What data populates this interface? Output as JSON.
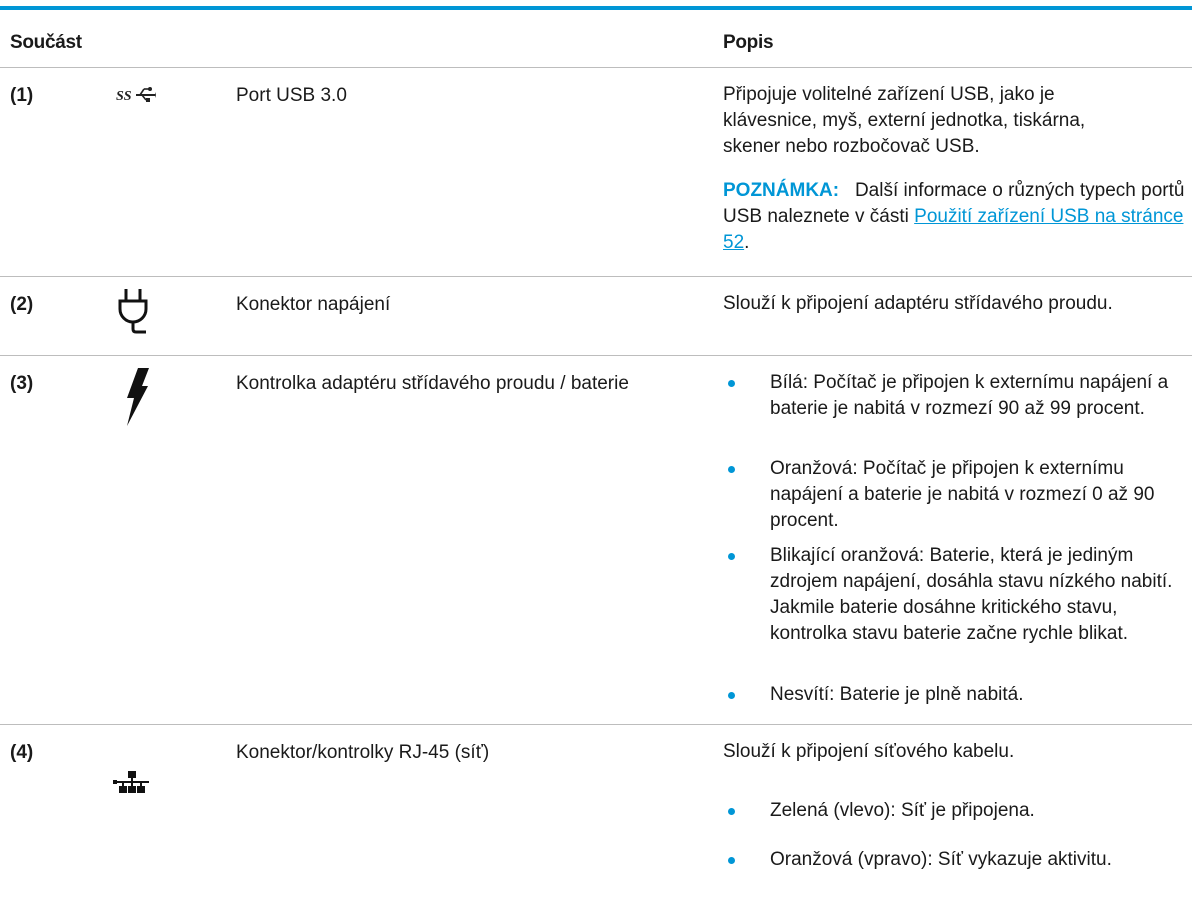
{
  "header": {
    "col1": "Součást",
    "col2": "Popis"
  },
  "rows": [
    {
      "num": "(1)",
      "icon": "superspeed-usb-icon",
      "name": "Port USB 3.0",
      "desc": "Připojuje volitelné zařízení USB, jako je klávesnice, myš, externí jednotka, tiskárna, skener nebo rozbočovač USB.",
      "note_label": "POZNÁMKA:",
      "note_text": "Další informace o různých typech portů USB naleznete v části",
      "note_link": "Použití zařízení USB na stránce 52",
      "note_end": "."
    },
    {
      "num": "(2)",
      "icon": "power-plug-icon",
      "name": "Konektor napájení",
      "desc": "Slouží k připojení adaptéru střídavého proudu."
    },
    {
      "num": "(3)",
      "icon": "lightning-bolt-icon",
      "name": "Kontrolka adaptéru střídavého proudu / baterie",
      "bullets": [
        "Bílá: Počítač je připojen k externímu napájení a baterie je nabitá v rozmezí 90 až 99 procent.",
        "Oranžová: Počítač je připojen k externímu napájení a baterie je nabitá v rozmezí 0 až 90 procent.",
        "Blikající oranžová: Baterie, která je jediným zdrojem napájení, dosáhla stavu nízkého nabití. Jakmile baterie dosáhne kritického stavu, kontrolka stavu baterie začne rychle blikat.",
        "Nesvítí: Baterie je plně nabitá."
      ]
    },
    {
      "num": "(4)",
      "icon": "network-icon",
      "name": "Konektor/kontrolky RJ-45 (síť)",
      "desc": "Slouží k připojení síťového kabelu.",
      "bullets": [
        "Zelená (vlevo): Síť je připojena.",
        "Oranžová (vpravo): Síť vykazuje aktivitu."
      ]
    }
  ],
  "colors": {
    "accent": "#0096d6",
    "rule": "#bdbdbd",
    "text": "#1a1a1a"
  }
}
